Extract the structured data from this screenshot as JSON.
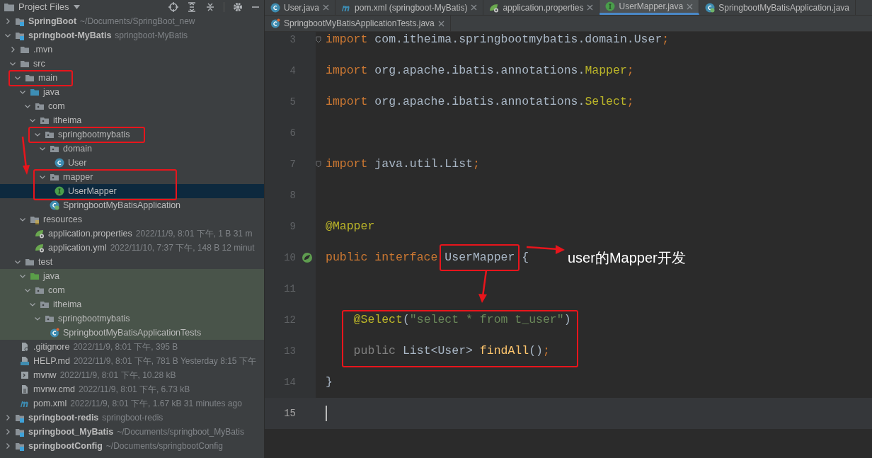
{
  "project_panel": {
    "title": "Project Files",
    "tree": [
      {
        "label": "SpringBoot",
        "meta": "~/Documents/SpringBoot_new",
        "kind": "module",
        "bold": true,
        "expanded": false,
        "selected": false,
        "tinted": false
      },
      {
        "label": "springboot-MyBatis",
        "meta": "springboot-MyBatis",
        "kind": "module",
        "bold": true,
        "expanded": true,
        "selected": false,
        "tinted": false,
        "children": [
          {
            "label": ".mvn",
            "kind": "folder",
            "bold": false,
            "expanded": false,
            "selected": false,
            "tinted": false
          },
          {
            "label": "src",
            "kind": "folder",
            "bold": false,
            "expanded": true,
            "selected": false,
            "tinted": false,
            "children": [
              {
                "label": "main",
                "kind": "folder",
                "bold": false,
                "expanded": true,
                "selected": false,
                "tinted": false,
                "boxed": true,
                "children": [
                  {
                    "label": "java",
                    "kind": "source-root",
                    "bold": false,
                    "expanded": true,
                    "selected": false,
                    "tinted": false,
                    "children": [
                      {
                        "label": "com",
                        "kind": "package",
                        "bold": false,
                        "expanded": true,
                        "selected": false,
                        "tinted": false,
                        "children": [
                          {
                            "label": "itheima",
                            "kind": "package",
                            "bold": false,
                            "expanded": true,
                            "selected": false,
                            "tinted": false,
                            "children": [
                              {
                                "label": "springbootmybatis",
                                "kind": "package",
                                "bold": false,
                                "expanded": true,
                                "selected": false,
                                "tinted": false,
                                "boxed": true,
                                "children": [
                                  {
                                    "label": "domain",
                                    "kind": "package",
                                    "bold": false,
                                    "expanded": true,
                                    "selected": false,
                                    "tinted": false,
                                    "children": [
                                      {
                                        "label": "User",
                                        "kind": "class",
                                        "bold": false,
                                        "selected": false,
                                        "tinted": false
                                      }
                                    ]
                                  },
                                  {
                                    "label": "mapper",
                                    "kind": "package",
                                    "bold": false,
                                    "expanded": true,
                                    "selected": false,
                                    "tinted": false,
                                    "children": [
                                      {
                                        "label": "UserMapper",
                                        "kind": "interface",
                                        "bold": false,
                                        "selected": true,
                                        "tinted": false
                                      }
                                    ]
                                  },
                                  {
                                    "label": "SpringbootMyBatisApplication",
                                    "kind": "boot-class",
                                    "bold": false,
                                    "selected": false,
                                    "tinted": false
                                  }
                                ]
                              }
                            ]
                          }
                        ]
                      }
                    ]
                  },
                  {
                    "label": "resources",
                    "kind": "resources-root",
                    "bold": false,
                    "expanded": true,
                    "selected": false,
                    "tinted": false,
                    "children": [
                      {
                        "label": "application.properties",
                        "meta": "2022/11/9, 8:01 下午, 1 B 31 m",
                        "kind": "spring-config",
                        "bold": false,
                        "selected": false,
                        "tinted": false
                      },
                      {
                        "label": "application.yml",
                        "meta": "2022/11/10, 7:37 下午, 148 B 12 minut",
                        "kind": "spring-config",
                        "bold": false,
                        "selected": false,
                        "tinted": false
                      }
                    ]
                  }
                ]
              },
              {
                "label": "test",
                "kind": "folder",
                "bold": false,
                "expanded": true,
                "selected": false,
                "tinted": false,
                "children": [
                  {
                    "label": "java",
                    "kind": "test-root",
                    "bold": false,
                    "expanded": true,
                    "selected": false,
                    "tinted": true,
                    "children": [
                      {
                        "label": "com",
                        "kind": "package",
                        "bold": false,
                        "expanded": true,
                        "selected": false,
                        "tinted": true,
                        "children": [
                          {
                            "label": "itheima",
                            "kind": "package",
                            "bold": false,
                            "expanded": true,
                            "selected": false,
                            "tinted": true,
                            "children": [
                              {
                                "label": "springbootmybatis",
                                "kind": "package",
                                "bold": false,
                                "expanded": true,
                                "selected": false,
                                "tinted": true,
                                "children": [
                                  {
                                    "label": "SpringbootMyBatisApplicationTests",
                                    "kind": "test-class",
                                    "bold": false,
                                    "selected": false,
                                    "tinted": true
                                  }
                                ]
                              }
                            ]
                          }
                        ]
                      }
                    ]
                  }
                ]
              }
            ]
          },
          {
            "label": ".gitignore",
            "meta": "2022/11/9, 8:01 下午, 395 B",
            "kind": "ignore-file",
            "bold": false,
            "selected": false,
            "tinted": false
          },
          {
            "label": "HELP.md",
            "meta": "2022/11/9, 8:01 下午, 781 B Yesterday 8:15 下午",
            "kind": "markdown-file",
            "bold": false,
            "selected": false,
            "tinted": false
          },
          {
            "label": "mvnw",
            "meta": "2022/11/9, 8:01 下午, 10.28 kB",
            "kind": "shell-file",
            "bold": false,
            "selected": false,
            "tinted": false
          },
          {
            "label": "mvnw.cmd",
            "meta": "2022/11/9, 8:01 下午, 6.73 kB",
            "kind": "text-file",
            "bold": false,
            "selected": false,
            "tinted": false
          },
          {
            "label": "pom.xml",
            "meta": "2022/11/9, 8:01 下午, 1.67 kB 31 minutes ago",
            "kind": "maven-file",
            "bold": false,
            "selected": false,
            "tinted": false
          }
        ]
      },
      {
        "label": "springboot-redis",
        "meta": "springboot-redis",
        "kind": "module",
        "bold": true,
        "expanded": false,
        "selected": false,
        "tinted": false
      },
      {
        "label": "springboot_MyBatis",
        "meta": "~/Documents/springboot_MyBatis",
        "kind": "module",
        "bold": true,
        "expanded": false,
        "selected": false,
        "tinted": false
      },
      {
        "label": "springbootConfig",
        "meta": "~/Documents/springbootConfig",
        "kind": "module",
        "bold": true,
        "expanded": false,
        "selected": false,
        "tinted": false
      }
    ]
  },
  "editor_tabs": [
    [
      {
        "label": "User.java",
        "kind": "class",
        "selected": false,
        "closable": true
      },
      {
        "label": "pom.xml (springboot-MyBatis)",
        "kind": "maven-file",
        "selected": false,
        "closable": true
      },
      {
        "label": "application.properties",
        "kind": "spring-config",
        "selected": false,
        "closable": true
      },
      {
        "label": "UserMapper.java",
        "kind": "interface",
        "selected": true,
        "closable": true
      },
      {
        "label": "SpringbootMyBatisApplication.java",
        "kind": "boot-class",
        "selected": false,
        "closable": false
      }
    ],
    [
      {
        "label": "SpringbootMyBatisApplicationTests.java",
        "kind": "test-class",
        "selected": false,
        "closable": true
      }
    ]
  ],
  "code_lines": [
    {
      "number": "3",
      "fold": true,
      "current": false,
      "tokens": [
        {
          "text": "import",
          "kind": "keyword"
        },
        {
          "text": " com.itheima.springbootmybatis.domain.User",
          "kind": "plain"
        },
        {
          "text": ";",
          "kind": "keyword"
        }
      ]
    },
    {
      "number": "4",
      "fold": false,
      "current": false,
      "tokens": [
        {
          "text": "import",
          "kind": "keyword"
        },
        {
          "text": " org.apache.ibatis.annotations.",
          "kind": "plain"
        },
        {
          "text": "Mapper",
          "kind": "annotation"
        },
        {
          "text": ";",
          "kind": "keyword"
        }
      ]
    },
    {
      "number": "5",
      "fold": false,
      "current": false,
      "tokens": [
        {
          "text": "import",
          "kind": "keyword"
        },
        {
          "text": " org.apache.ibatis.annotations.",
          "kind": "plain"
        },
        {
          "text": "Select",
          "kind": "annotation"
        },
        {
          "text": ";",
          "kind": "keyword"
        }
      ]
    },
    {
      "number": "6",
      "fold": false,
      "current": false
    },
    {
      "number": "7",
      "fold": true,
      "current": false,
      "tokens": [
        {
          "text": "import",
          "kind": "keyword"
        },
        {
          "text": " java.util.List",
          "kind": "plain"
        },
        {
          "text": ";",
          "kind": "keyword"
        }
      ]
    },
    {
      "number": "8",
      "fold": false,
      "current": false
    },
    {
      "number": "9",
      "fold": false,
      "current": false,
      "tokens": [
        {
          "text": "@Mapper",
          "kind": "annotation"
        }
      ]
    },
    {
      "number": "10",
      "fold": false,
      "current": false,
      "kind": "bean-marked",
      "tokens": [
        {
          "text": "public interface ",
          "kind": "keyword"
        },
        {
          "text": "UserMapper",
          "kind": "plain",
          "boxed": true
        },
        {
          "text": " {",
          "kind": "plain"
        }
      ]
    },
    {
      "number": "11",
      "fold": false,
      "current": false
    },
    {
      "number": "12",
      "fold": false,
      "current": false,
      "tokens": [
        {
          "text": "    @Select",
          "kind": "annotation"
        },
        {
          "text": "(",
          "kind": "plain"
        },
        {
          "text": "\"select * from t_user\"",
          "kind": "string"
        },
        {
          "text": ")",
          "kind": "plain"
        }
      ]
    },
    {
      "number": "13",
      "fold": false,
      "current": false,
      "tokens": [
        {
          "text": "    public",
          "kind": "muted"
        },
        {
          "text": " List<User> ",
          "kind": "plain"
        },
        {
          "text": "findAll",
          "kind": "method"
        },
        {
          "text": "()",
          "kind": "plain"
        },
        {
          "text": ";",
          "kind": "keyword"
        }
      ]
    },
    {
      "number": "14",
      "fold": false,
      "current": false,
      "tokens": [
        {
          "text": "}",
          "kind": "plain"
        }
      ]
    },
    {
      "number": "15",
      "fold": false,
      "current": true
    }
  ],
  "annotation": {
    "note": "user的Mapper开发"
  }
}
